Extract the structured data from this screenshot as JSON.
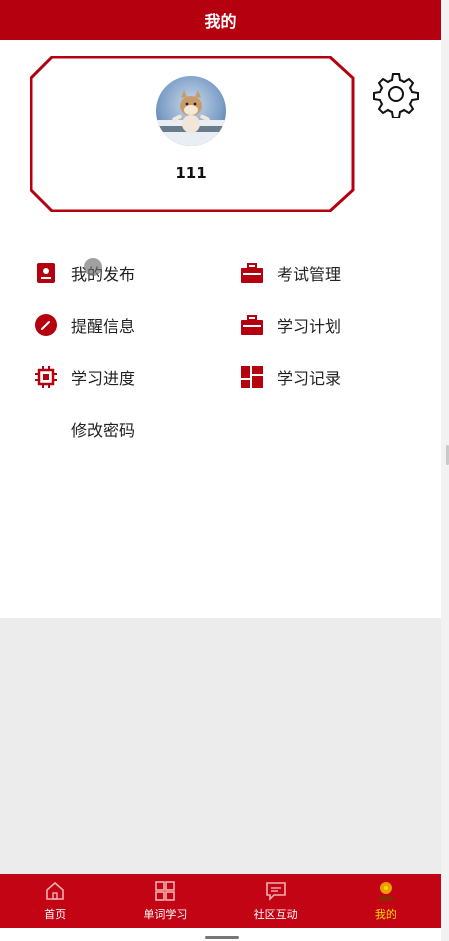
{
  "header": {
    "title": "我的"
  },
  "profile": {
    "username": "111"
  },
  "menu": {
    "items": [
      {
        "label": "我的发布",
        "icon": "document-icon"
      },
      {
        "label": "考试管理",
        "icon": "briefcase-icon"
      },
      {
        "label": "提醒信息",
        "icon": "edit-circle-icon"
      },
      {
        "label": "学习计划",
        "icon": "briefcase-icon"
      },
      {
        "label": "学习进度",
        "icon": "chip-icon"
      },
      {
        "label": "学习记录",
        "icon": "grid-icon"
      },
      {
        "label": "修改密码",
        "icon": ""
      }
    ]
  },
  "tabbar": {
    "tabs": [
      {
        "label": "首页",
        "icon": "home-icon"
      },
      {
        "label": "单词学习",
        "icon": "grid-icon"
      },
      {
        "label": "社区互动",
        "icon": "chat-icon"
      },
      {
        "label": "我的",
        "icon": "user-icon"
      }
    ],
    "active_index": 3
  },
  "colors": {
    "brand_red": "#b5000f",
    "tabbar_red": "#c20414",
    "active_tab": "#ffd700"
  }
}
